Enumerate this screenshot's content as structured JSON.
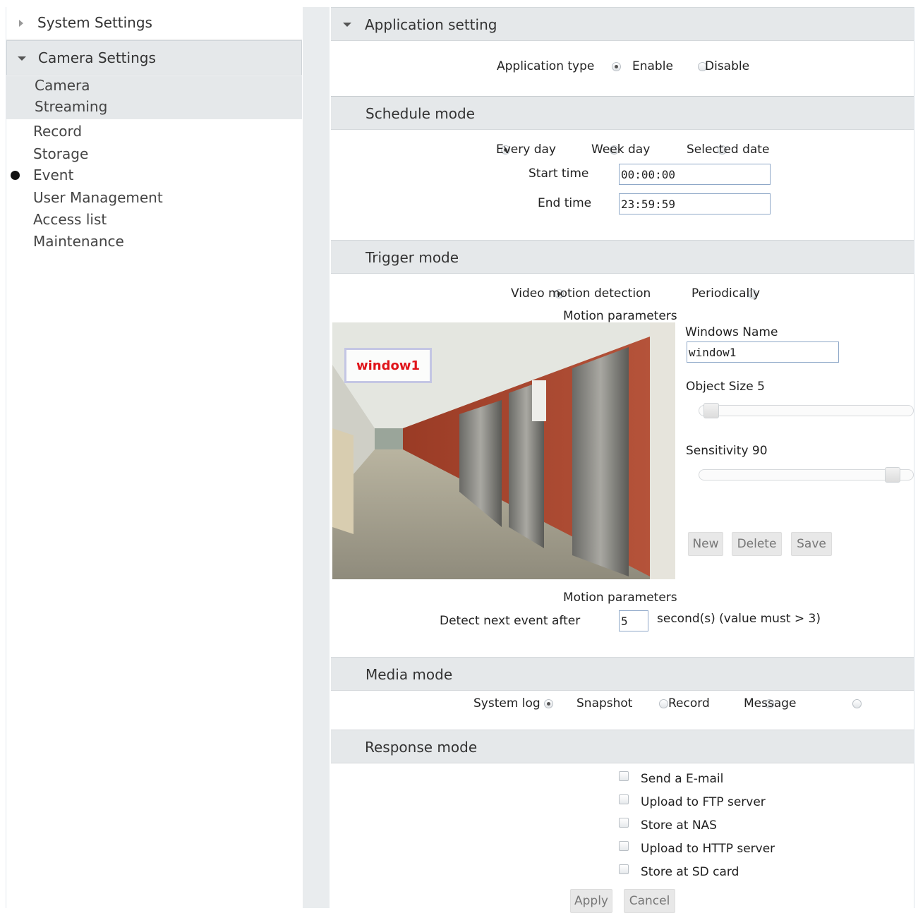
{
  "sidebar": {
    "system_settings": "System Settings",
    "camera_settings": "Camera Settings",
    "camera_items": [
      "Camera",
      "Streaming"
    ],
    "items": [
      "Record",
      "Storage",
      "Event",
      "User Management",
      "Access list",
      "Maintenance"
    ]
  },
  "app_setting": {
    "title": "Application setting",
    "type_label": "Application type",
    "enable": "Enable",
    "disable": "Disable"
  },
  "schedule": {
    "title": "Schedule mode",
    "every_day": "Every day",
    "week_day": "Week day",
    "selected_date": "Selected date",
    "start_label": "Start time",
    "start_value": "00:00:00",
    "end_label": "End time",
    "end_value": "23:59:59"
  },
  "trigger": {
    "title": "Trigger mode",
    "video_motion": "Video motion detection",
    "periodically": "Periodically",
    "motion_params": "Motion parameters",
    "window_overlay": "window1",
    "windows_name_label": "Windows Name",
    "windows_name_value": "window1",
    "object_size_label": "Object Size 5",
    "object_size_level": 5,
    "sensitivity_label": "Sensitivity 90",
    "sensitivity_level": 90,
    "new": "New",
    "delete": "Delete",
    "save": "Save",
    "motion_params_2": "Motion parameters",
    "detect_label": "Detect next event after",
    "detect_value": "5",
    "detect_suffix": "second(s) (value must > 3)"
  },
  "media": {
    "title": "Media mode",
    "options": [
      "System log",
      "Snapshot",
      "Record",
      "Message"
    ]
  },
  "response": {
    "title": "Response mode",
    "options": [
      "Send a E-mail",
      "Upload to FTP server",
      "Store at NAS",
      "Upload to HTTP server",
      "Store at SD card"
    ],
    "apply": "Apply",
    "cancel": "Cancel"
  }
}
